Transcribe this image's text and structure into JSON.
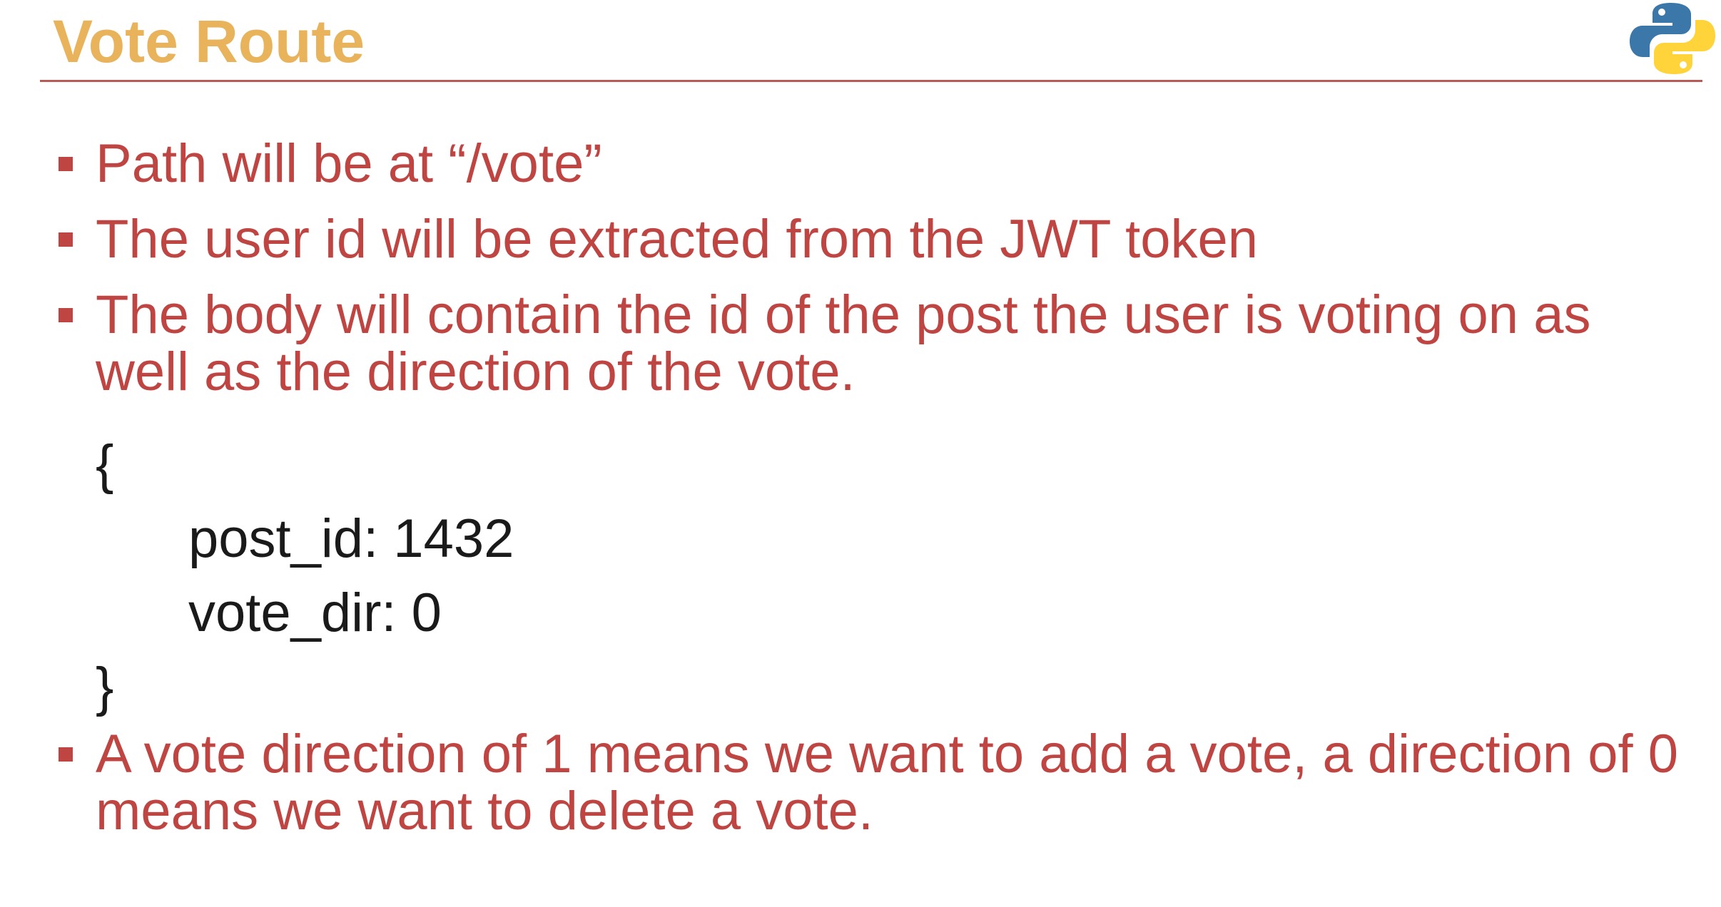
{
  "slide": {
    "title": "Vote Route",
    "logo": "python-logo-icon",
    "colors": {
      "title": "#e8b35a",
      "rule": "#b85a55",
      "bullet_text": "#bf4542",
      "code_text": "#1a1a1a",
      "python_blue": "#3b77a8",
      "python_yellow": "#ffd43b"
    },
    "bullets": [
      "Path will be at “/vote”",
      "The user id will be extracted from the JWT token",
      "The body will contain the id of the post the user is voting on as well as the direction of the vote."
    ],
    "code": {
      "open": "{",
      "line1": "post_id: 1432",
      "line2": "vote_dir: 0",
      "close": "}"
    },
    "last_bullet": "A vote direction of 1 means we want to add a vote, a direction of 0 means we want to delete a vote."
  }
}
